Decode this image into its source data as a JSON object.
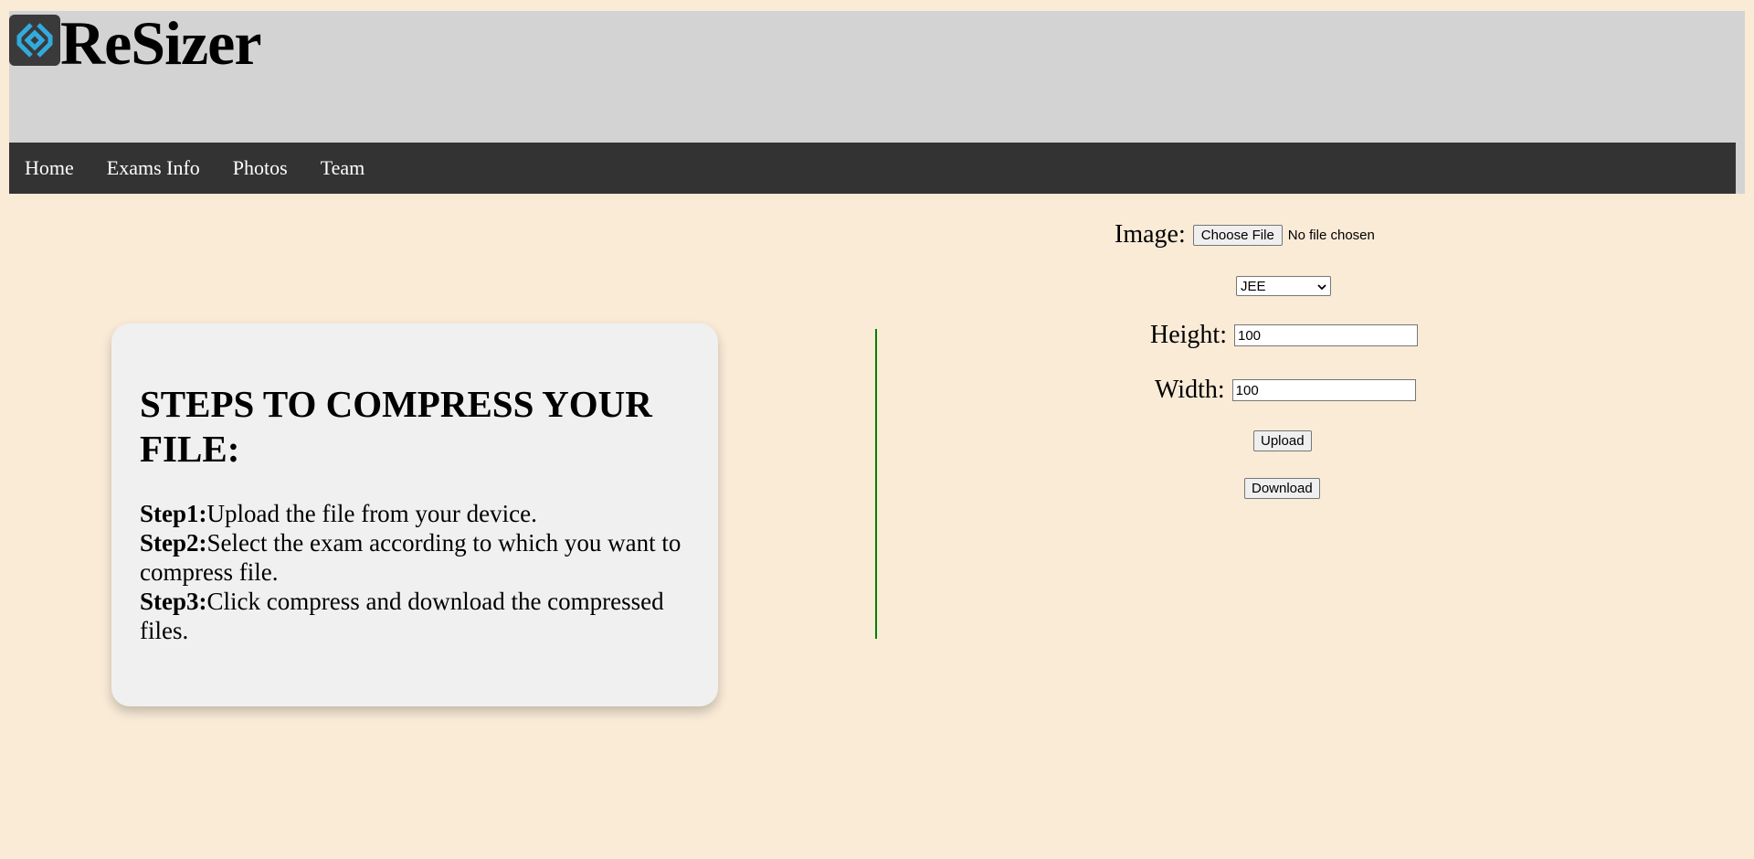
{
  "brand": {
    "name": "ReSizer",
    "icon": "resizer-logo-icon",
    "icon_bg": "#3a3a3a",
    "icon_color": "#33aadd"
  },
  "nav": {
    "items": [
      {
        "label": "Home"
      },
      {
        "label": "Exams Info"
      },
      {
        "label": "Photos"
      },
      {
        "label": "Team"
      }
    ]
  },
  "steps": {
    "title": "STEPS TO COMPRESS YOUR FILE:",
    "items": [
      {
        "label": "Step1:",
        "text": "Upload the file from your device."
      },
      {
        "label": "Step2:",
        "text": "Select the exam according to which you want to compress file."
      },
      {
        "label": "Step3:",
        "text": "Click compress and download the compressed files."
      }
    ]
  },
  "form": {
    "image_label": "Image:",
    "choose_file_label": "Choose File",
    "file_status": "No file chosen",
    "exam_select": {
      "selected": "JEE"
    },
    "height_label": "Height:",
    "height_value": "100",
    "width_label": "Width:",
    "width_value": "100",
    "upload_label": "Upload",
    "download_label": "Download"
  },
  "colors": {
    "page_bg": "#faebd7",
    "header_bg": "#d3d3d3",
    "nav_bg": "#333333",
    "card_bg": "#f0f0f0",
    "divider": "#008000"
  }
}
